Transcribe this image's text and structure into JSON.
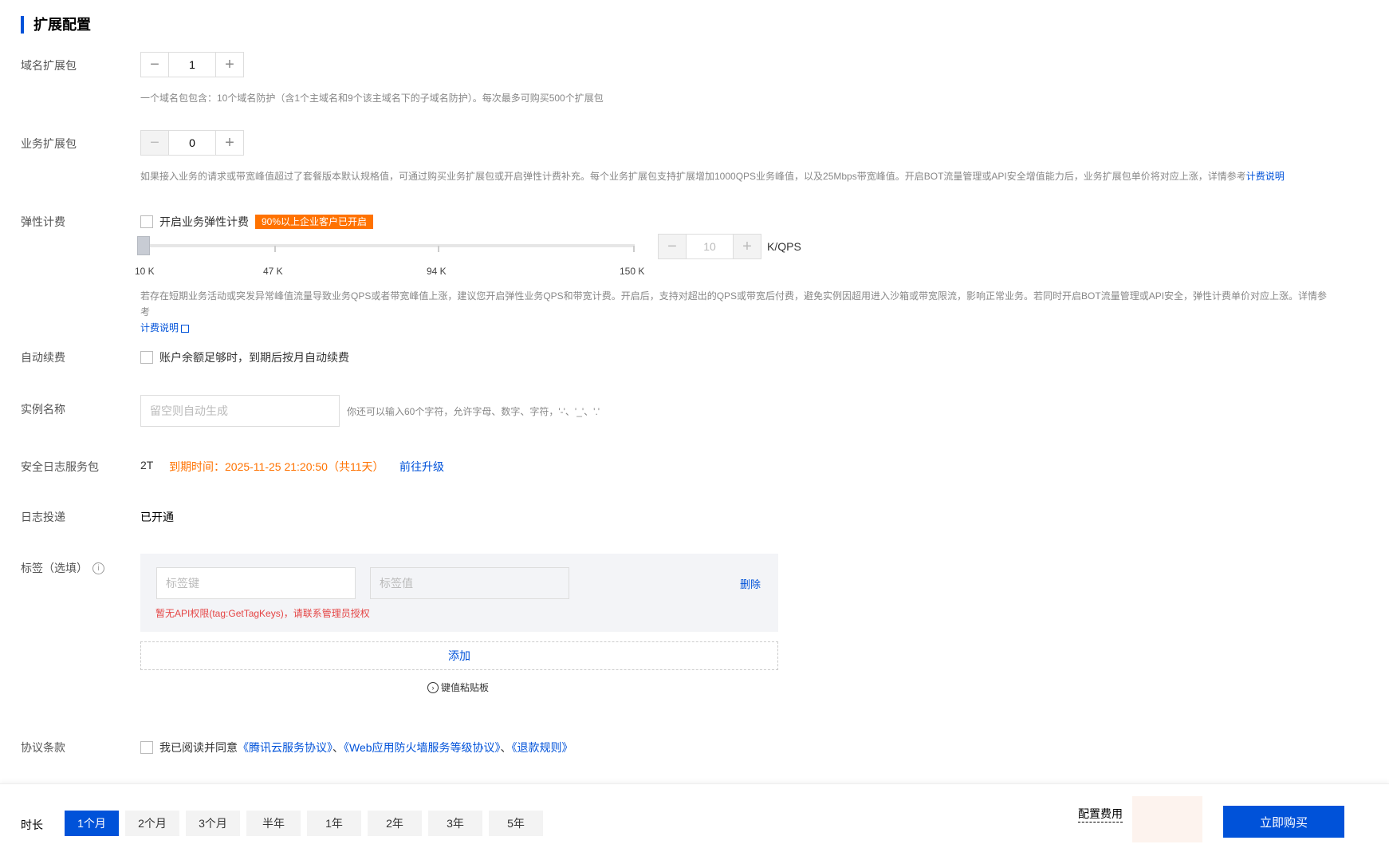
{
  "section_title": "扩展配置",
  "domain_pack": {
    "label": "域名扩展包",
    "value": "1",
    "hint": "一个域名包包含：10个域名防护（含1个主域名和9个该主域名下的子域名防护）。每次最多可购买500个扩展包"
  },
  "business_pack": {
    "label": "业务扩展包",
    "value": "0",
    "hint": "如果接入业务的请求或带宽峰值超过了套餐版本默认规格值，可通过购买业务扩展包或开启弹性计费补充。每个业务扩展包支持扩展增加1000QPS业务峰值，以及25Mbps带宽峰值。开启BOT流量管理或API安全增值能力后，业务扩展包单价将对应上涨，详情参考",
    "hint_link": "计费说明"
  },
  "elastic": {
    "label": "弹性计费",
    "checkbox_label": "开启业务弹性计费",
    "badge": "90%以上企业客户已开启",
    "slider_ticks": [
      "10 K",
      "47 K",
      "94 K",
      "150 K"
    ],
    "slider_value_fraction": 0,
    "stepper_value": "10",
    "unit": "K/QPS",
    "hint": "若存在短期业务活动或突发异常峰值流量导致业务QPS或者带宽峰值上涨，建议您开启弹性业务QPS和带宽计费。开启后，支持对超出的QPS或带宽后付费，避免实例因超用进入沙箱或带宽限流，影响正常业务。若同时开启BOT流量管理或API安全，弹性计费单价对应上涨。详情参考",
    "hint_link": "计费说明"
  },
  "auto_renew": {
    "label": "自动续费",
    "checkbox_label": "账户余额足够时，到期后按月自动续费"
  },
  "instance_name": {
    "label": "实例名称",
    "placeholder": "留空则自动生成",
    "hint": "你还可以输入60个字符，允许字母、数字、字符，'-'、'_'、'.'"
  },
  "log_service": {
    "label": "安全日志服务包",
    "size": "2T",
    "expiry": "到期时间：2025-11-25 21:20:50（共11天）",
    "upgrade_link": "前往升级"
  },
  "log_delivery": {
    "label": "日志投递",
    "value": "已开通"
  },
  "tags": {
    "label": "标签（选填）",
    "key_placeholder": "标签键",
    "value_placeholder": "标签值",
    "delete_label": "删除",
    "error": "暂无API权限(tag:GetTagKeys)，请联系管理员授权",
    "add_label": "添加",
    "paste_label": "键值粘贴板"
  },
  "agreement": {
    "label": "协议条款",
    "prefix": "我已阅读并同意",
    "link1": "《腾讯云服务协议》",
    "sep1": "、",
    "link2": "《Web应用防火墙服务等级协议》",
    "sep2": "、",
    "link3": "《退款规则》"
  },
  "footer": {
    "duration_label": "时长",
    "durations": [
      "1个月",
      "2个月",
      "3个月",
      "半年",
      "1年",
      "2年",
      "3年",
      "5年"
    ],
    "active_duration_index": 0,
    "config_fee_label": "配置费用",
    "buy_label": "立即购买"
  },
  "colors": {
    "primary": "#0052d9",
    "orange": "#ff7200",
    "error": "#e54545"
  }
}
